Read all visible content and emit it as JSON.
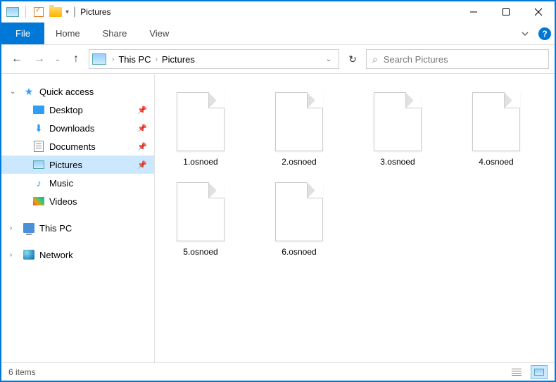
{
  "window": {
    "title": "Pictures"
  },
  "ribbon": {
    "file": "File",
    "tabs": [
      "Home",
      "Share",
      "View"
    ]
  },
  "breadcrumb": {
    "items": [
      "This PC",
      "Pictures"
    ]
  },
  "search": {
    "placeholder": "Search Pictures"
  },
  "sidebar": {
    "quick_access": {
      "label": "Quick access",
      "items": [
        {
          "label": "Desktop",
          "icon": "desktop",
          "pinned": true
        },
        {
          "label": "Downloads",
          "icon": "downloads",
          "pinned": true
        },
        {
          "label": "Documents",
          "icon": "documents",
          "pinned": true
        },
        {
          "label": "Pictures",
          "icon": "pictures",
          "pinned": true,
          "selected": true
        },
        {
          "label": "Music",
          "icon": "music",
          "pinned": false
        },
        {
          "label": "Videos",
          "icon": "videos",
          "pinned": false
        }
      ]
    },
    "this_pc": {
      "label": "This PC"
    },
    "network": {
      "label": "Network"
    }
  },
  "files": [
    {
      "name": "1.osnoed"
    },
    {
      "name": "2.osnoed"
    },
    {
      "name": "3.osnoed"
    },
    {
      "name": "4.osnoed"
    },
    {
      "name": "5.osnoed"
    },
    {
      "name": "6.osnoed"
    }
  ],
  "statusbar": {
    "count_label": "6 items"
  }
}
